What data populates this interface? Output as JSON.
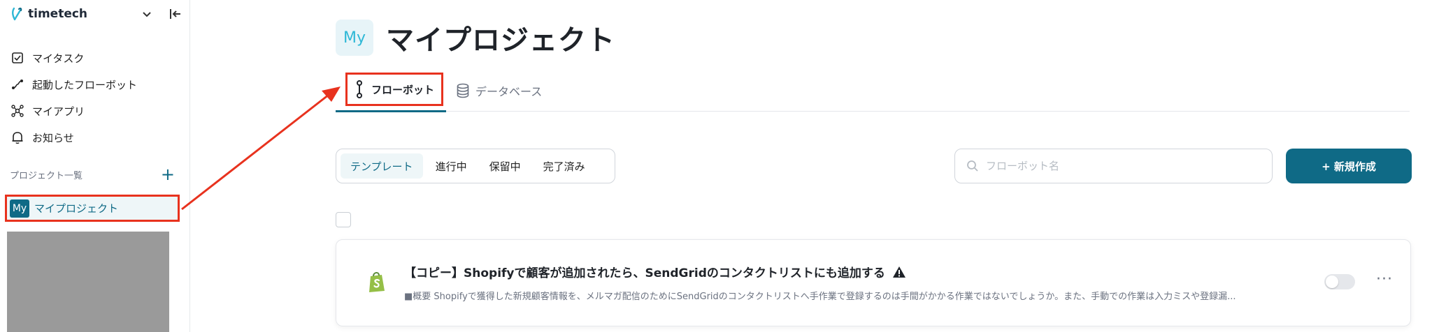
{
  "sidebar": {
    "brand": "timetech",
    "nav": [
      {
        "label": "マイタスク",
        "icon": "checkbox-icon"
      },
      {
        "label": "起動したフローボット",
        "icon": "flow-icon"
      },
      {
        "label": "マイアプリ",
        "icon": "apps-icon"
      },
      {
        "label": "お知らせ",
        "icon": "bell-icon"
      }
    ],
    "projects_label": "プロジェクト一覧",
    "add_project": "+",
    "project": {
      "badge": "My",
      "label": "マイプロジェクト"
    }
  },
  "header": {
    "badge": "My",
    "title": "マイプロジェクト"
  },
  "tabs": [
    {
      "label": "フローボット",
      "active": true
    },
    {
      "label": "データベース",
      "active": false
    }
  ],
  "filters": [
    {
      "label": "テンプレート",
      "active": true
    },
    {
      "label": "進行中",
      "active": false
    },
    {
      "label": "保留中",
      "active": false
    },
    {
      "label": "完了済み",
      "active": false
    }
  ],
  "search": {
    "placeholder": "フローボット名"
  },
  "new_button": "+ 新規作成",
  "flowbot": {
    "title": "【コピー】Shopifyで顧客が追加されたら、SendGridのコンタクトリストにも追加する",
    "description": "■概要 Shopifyで獲得した新規顧客情報を、メルマガ配信のためにSendGridのコンタクトリストへ手作業で登録するのは手間がかかる作業ではないでしょうか。また、手動での作業は入力ミスや登録漏...",
    "enabled": false,
    "more": "···"
  },
  "colors": {
    "accent": "#0f6a86",
    "highlight": "#e8321e",
    "shopify": "#95bf47"
  }
}
